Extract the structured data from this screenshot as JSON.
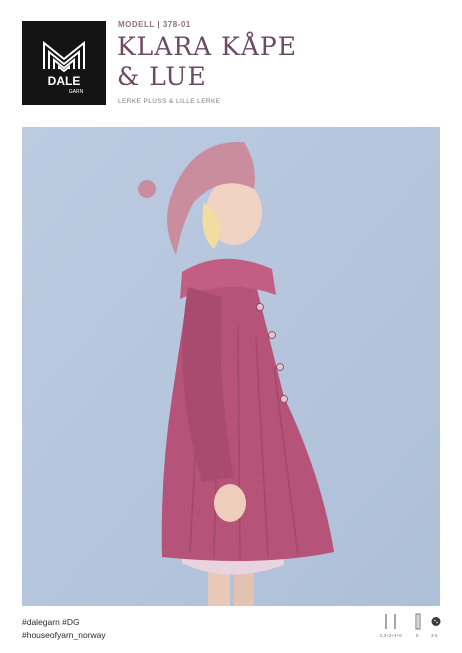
{
  "brand": {
    "logo_text": "DALE",
    "logo_subtext": "GARN"
  },
  "header": {
    "modell_label": "MODELL | 378-01",
    "title_line1": "KLARA KÅPE",
    "title_line2": "& LUE",
    "subtitle": "LERKE PLUSS & LILLE LERKE"
  },
  "hashtags": {
    "line1": "#dalegarn #DG",
    "line2": "#houseofyarn_norway"
  },
  "specs": {
    "sizes": "2,3+3+4+5",
    "needle_size": "5",
    "button_count": "3-5"
  },
  "colors": {
    "brand_dark": "#141414",
    "title_color": "#6d4a64",
    "backdrop": "#b6c7dd",
    "coat": "#b55378"
  }
}
